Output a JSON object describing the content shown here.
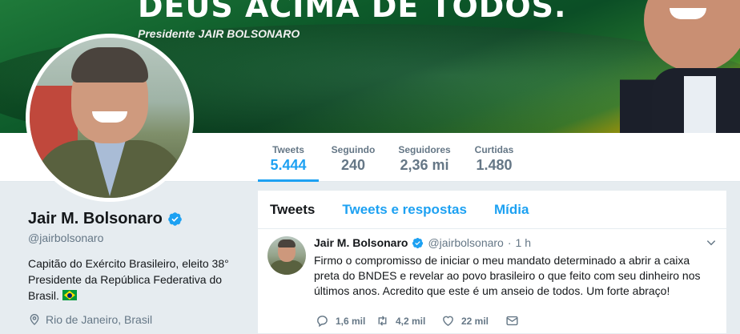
{
  "banner": {
    "slogan": "DEUS ACIMA DE TODOS.",
    "subtitle": "Presidente JAIR BOLSONARO"
  },
  "nav": {
    "stats": [
      {
        "label": "Tweets",
        "value": "5.444",
        "active": true
      },
      {
        "label": "Seguindo",
        "value": "240",
        "active": false
      },
      {
        "label": "Seguidores",
        "value": "2,36 mi",
        "active": false
      },
      {
        "label": "Curtidas",
        "value": "1.480",
        "active": false
      }
    ]
  },
  "profile": {
    "name": "Jair M. Bolsonaro",
    "handle": "@jairbolsonaro",
    "bio": "Capitão do Exército Brasileiro, eleito 38° Presidente da República Federativa do Brasil.",
    "location": "Rio de Janeiro, Brasil"
  },
  "timeline": {
    "tabs": [
      {
        "label": "Tweets",
        "active": true
      },
      {
        "label": "Tweets e respostas",
        "active": false
      },
      {
        "label": "Mídia",
        "active": false
      }
    ]
  },
  "tweet": {
    "name": "Jair M. Bolsonaro",
    "handle": "@jairbolsonaro",
    "separator": "·",
    "time": "1 h",
    "text": "Firmo o compromisso de iniciar o meu mandato determinado a abrir a caixa preta do BNDES e revelar ao povo brasileiro o que feito com seu dinheiro nos últimos anos. Acredito que este é um anseio de todos. Um forte abraço!",
    "replies": "1,6 mil",
    "retweets": "4,2 mil",
    "likes": "22 mil"
  },
  "colors": {
    "accent": "#1da1f2",
    "text": "#14171a",
    "muted": "#657786",
    "background": "#e6ecf0",
    "banner_green": "#0d5a2a"
  },
  "icons": [
    "verified-badge-icon",
    "brazil-flag-icon",
    "location-pin-icon",
    "chevron-down-icon",
    "reply-icon",
    "retweet-icon",
    "like-icon",
    "direct-message-icon"
  ]
}
